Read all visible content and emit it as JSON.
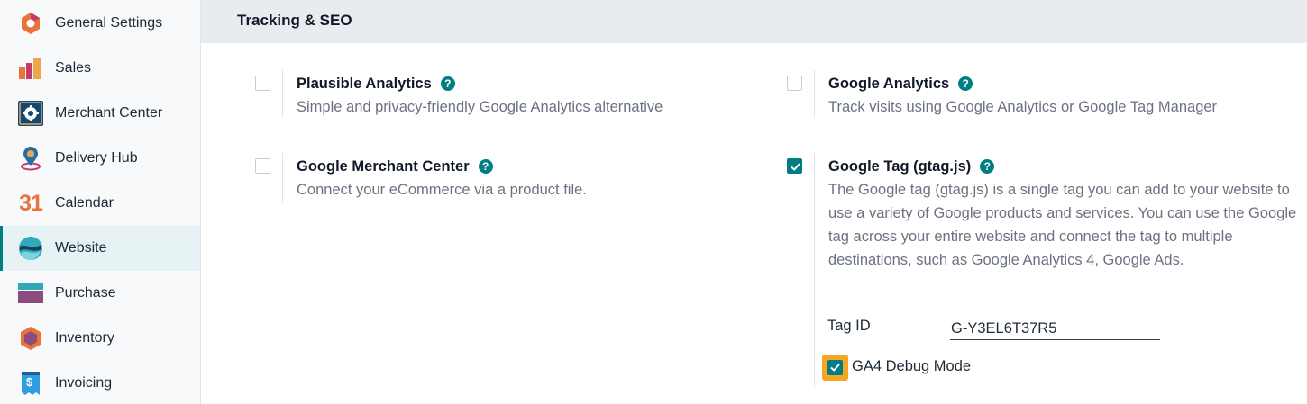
{
  "sidebar": {
    "items": [
      {
        "label": "General Settings",
        "icon": "general-settings-icon"
      },
      {
        "label": "Sales",
        "icon": "sales-icon"
      },
      {
        "label": "Merchant Center",
        "icon": "merchant-center-icon"
      },
      {
        "label": "Delivery Hub",
        "icon": "delivery-hub-icon"
      },
      {
        "label": "Calendar",
        "icon": "calendar-icon",
        "icon_text": "31"
      },
      {
        "label": "Website",
        "icon": "website-icon",
        "active": true
      },
      {
        "label": "Purchase",
        "icon": "purchase-icon"
      },
      {
        "label": "Inventory",
        "icon": "inventory-icon"
      },
      {
        "label": "Invoicing",
        "icon": "invoicing-icon",
        "icon_text": "$"
      }
    ]
  },
  "section": {
    "title": "Tracking & SEO"
  },
  "settings": {
    "plausible": {
      "title": "Plausible Analytics",
      "description": "Simple and privacy-friendly Google Analytics alternative",
      "checked": false
    },
    "google_analytics": {
      "title": "Google Analytics",
      "description": "Track visits using Google Analytics or Google Tag Manager",
      "checked": false
    },
    "merchant_center": {
      "title": "Google Merchant Center",
      "description": "Connect your eCommerce via a product file.",
      "checked": false
    },
    "gtag": {
      "title": "Google Tag (gtag.js)",
      "description": "The Google tag (gtag.js) is a single tag you can add to your website to use a variety of Google products and services. You can use the Google tag across your entire website and connect the tag to multiple destinations, such as Google Analytics 4, Google Ads.",
      "checked": true,
      "tag_id_label": "Tag ID",
      "tag_id_value": "G-Y3EL6T37R5",
      "debug_label": "GA4 Debug Mode",
      "debug_checked": true
    }
  },
  "help_glyph": "?",
  "colors": {
    "accent": "#017e84",
    "highlight": "#f5a623"
  }
}
